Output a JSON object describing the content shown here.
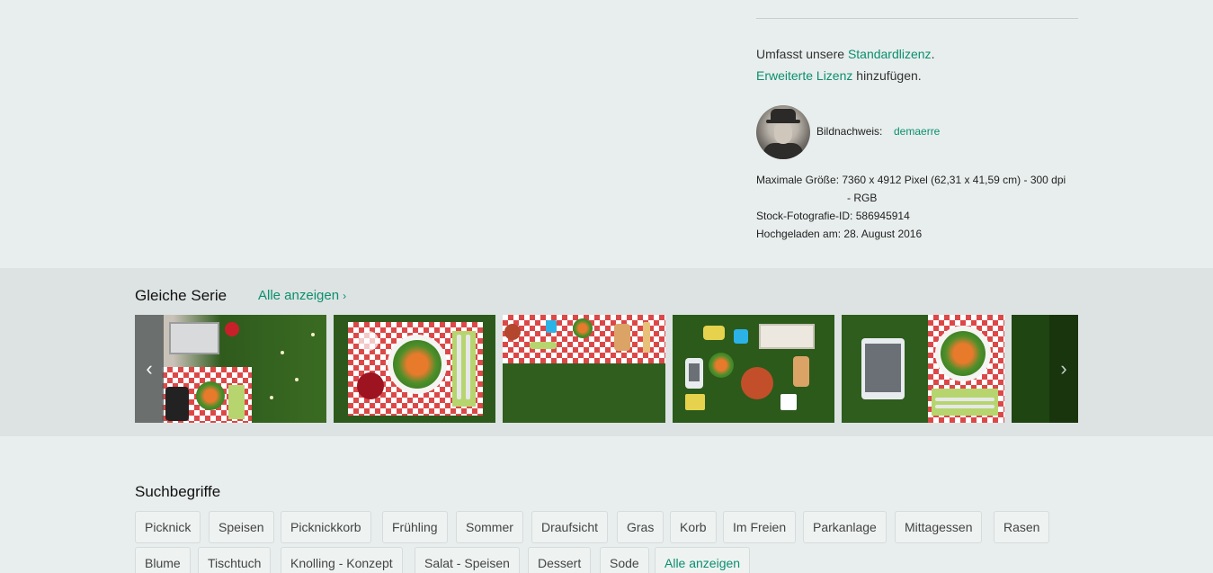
{
  "license": {
    "line1_prefix": "Umfasst unsere ",
    "line1_link": "Standardlizenz",
    "line1_suffix": ".",
    "line2_link": "Erweiterte Lizenz",
    "line2_suffix": " hinzufügen."
  },
  "credit": {
    "label": "Bildnachweis:",
    "name": "demaerre"
  },
  "meta": {
    "max_size_label": "Maximale Größe:",
    "max_size_value": "7360 x 4912 Pixel (62,31 x 41,59 cm) - 300 dpi",
    "max_size_value_cont": "- RGB",
    "id_label": "Stock-Fotografie-ID:",
    "id_value": "586945914",
    "uploaded_label": "Hochgeladen am:",
    "uploaded_value": "28. August 2016"
  },
  "series": {
    "title": "Gleiche Serie",
    "all_label": "Alle anzeigen",
    "prev_icon": "chevron-left-icon",
    "next_icon": "chevron-right-icon"
  },
  "terms": {
    "title": "Suchbegriffe",
    "row1": [
      "Picknick",
      "Speisen",
      "Picknickkorb",
      "Frühling",
      "Sommer",
      "Draufsicht",
      "Gras",
      "Korb",
      "Im Freien",
      "Parkanlage",
      "Mittagessen",
      "Rasen"
    ],
    "row2": [
      "Blume",
      "Tischtuch",
      "Knolling - Konzept",
      "Salat - Speisen",
      "Dessert",
      "Sode"
    ],
    "all_label": "Alle anzeigen"
  },
  "colors": {
    "link": "#0b8f6f",
    "background": "#e8eeed",
    "band": "#dde3e2"
  }
}
